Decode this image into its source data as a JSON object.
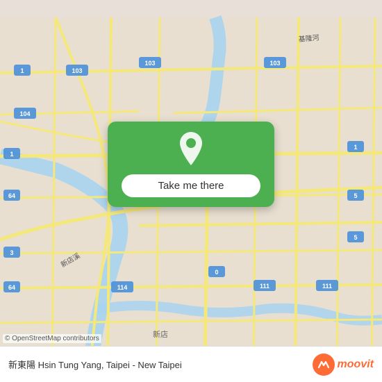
{
  "map": {
    "background_color": "#e8dfd0",
    "center": "Taipei"
  },
  "button_card": {
    "button_label": "Take me there",
    "background_color": "#4caf50",
    "pin_icon": "location-pin-icon"
  },
  "bottom_bar": {
    "location_name": "新東陽 Hsin Tung Yang, Taipei - New Taipei",
    "attribution": "© OpenStreetMap contributors",
    "logo_text": "moovit",
    "logo_icon_char": "m"
  }
}
